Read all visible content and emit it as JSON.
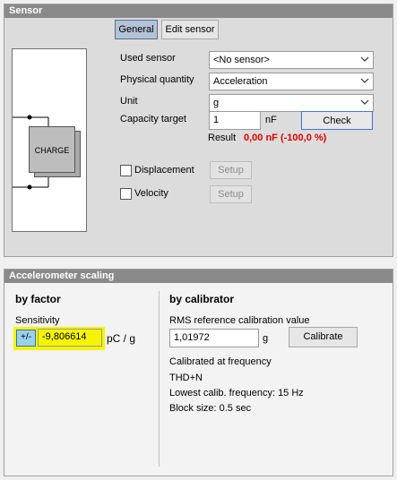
{
  "sensor_panel": {
    "title": "Sensor",
    "tabs": [
      {
        "label": "General"
      },
      {
        "label": "Edit sensor"
      }
    ],
    "diagram": {
      "label": "CHARGE"
    },
    "fields": {
      "used_sensor": {
        "label": "Used sensor",
        "value": "<No sensor>"
      },
      "physical_quantity": {
        "label": "Physical quantity",
        "value": "Acceleration"
      },
      "unit": {
        "label": "Unit",
        "value": "g"
      },
      "capacity_target": {
        "label": "Capacity target",
        "value": "1",
        "unit": "nF",
        "check_label": "Check"
      }
    },
    "result": {
      "label": "Result",
      "value": "0,00 nF (-100,0 %)",
      "color": "#e00000"
    },
    "displacement": {
      "label": "Displacement",
      "setup_label": "Setup",
      "checked": false
    },
    "velocity": {
      "label": "Velocity",
      "setup_label": "Setup",
      "checked": false
    }
  },
  "scaling_panel": {
    "title": "Accelerometer scaling",
    "by_factor": {
      "heading": "by factor",
      "sensitivity_label": "Sensitivity",
      "sign_label": "+/-",
      "sensitivity_value": "-9,806614",
      "unit": "pC / g",
      "highlight_color": "#f5f500"
    },
    "by_calibrator": {
      "heading": "by calibrator",
      "rms_label": "RMS reference calibration value",
      "rms_value": "1,01972",
      "rms_unit": "g",
      "calibrate_label": "Calibrate",
      "calibrated_at": "Calibrated at frequency",
      "thd": "THD+N",
      "lowest_freq": "Lowest calib. frequency: 15 Hz",
      "block_size": "Block size: 0.5 sec"
    }
  }
}
